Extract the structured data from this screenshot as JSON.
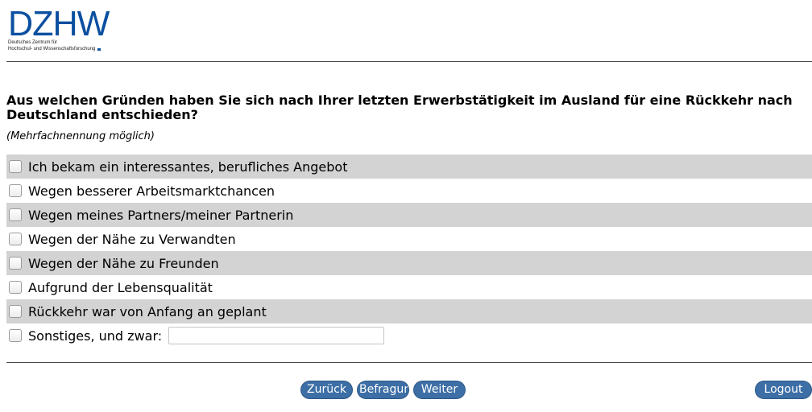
{
  "logo": {
    "wordmark": "DZHW",
    "subtitle_line1": "Deutsches Zentrum für",
    "subtitle_line2": "Hochschul- und Wissenschaftsforschung"
  },
  "question": {
    "text": "Aus welchen Gründen haben Sie sich nach Ihrer letzten Erwerbstätigkeit im Ausland für eine Rückkehr nach Deutschland entschieden?",
    "hint": "(Mehrfachnennung möglich)"
  },
  "options": [
    {
      "label": "Ich bekam ein interessantes, berufliches Angebot",
      "checked": false
    },
    {
      "label": "Wegen besserer Arbeitsmarktchancen",
      "checked": false
    },
    {
      "label": "Wegen meines Partners/meiner Partnerin",
      "checked": false
    },
    {
      "label": "Wegen der Nähe zu Verwandten",
      "checked": false
    },
    {
      "label": "Wegen der Nähe zu Freunden",
      "checked": false
    },
    {
      "label": "Aufgrund der Lebensqualität",
      "checked": false
    },
    {
      "label": "Rückkehr war von Anfang an geplant",
      "checked": false
    },
    {
      "label": "Sonstiges, und zwar:",
      "checked": false,
      "input_value": ""
    }
  ],
  "nav": {
    "back_label": "Zurück",
    "survey_label": "Befragung",
    "next_label": "Weiter",
    "logout_label": "Logout"
  },
  "colors": {
    "brand_blue": "#0b4fa0",
    "button_blue": "#3d6fa6",
    "row_shade": "#d3d3d3"
  }
}
